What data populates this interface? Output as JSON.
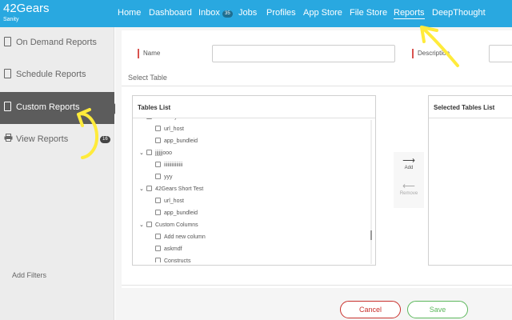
{
  "brand": {
    "name": "42Gears",
    "subtitle": "Sanity"
  },
  "nav": {
    "items": [
      {
        "label": "Home"
      },
      {
        "label": "Dashboard"
      },
      {
        "label": "Inbox",
        "badge": "35"
      },
      {
        "label": "Jobs"
      },
      {
        "label": "Profiles"
      },
      {
        "label": "App Store"
      },
      {
        "label": "File Store"
      },
      {
        "label": "Reports",
        "active": true
      },
      {
        "label": "DeepThought"
      }
    ]
  },
  "sidebar": {
    "items": [
      {
        "label": "On Demand Reports",
        "icon": "document-icon"
      },
      {
        "label": "Schedule Reports",
        "icon": "document-icon"
      },
      {
        "label": "Custom Reports",
        "icon": "document-icon",
        "active": true
      },
      {
        "label": "View Reports",
        "icon": "printer-icon",
        "badge": "16"
      }
    ]
  },
  "form": {
    "name_label": "Name",
    "description_label": "Description",
    "name_value": "",
    "description_value": "",
    "select_table_title": "Select Table",
    "tables_list_title": "Tables List",
    "selected_tables_title": "Selected Tables List",
    "add_label": "Add",
    "remove_label": "Remove",
    "add_filters_label": "Add Filters"
  },
  "tables_tree": [
    {
      "level": 0,
      "label": "ios analytics",
      "expanded": true
    },
    {
      "level": 1,
      "label": "url_host"
    },
    {
      "level": 1,
      "label": "app_bundleid"
    },
    {
      "level": 0,
      "label": "jjjjjjooo",
      "expanded": true
    },
    {
      "level": 1,
      "label": "iiiiiiiiiiiiiii"
    },
    {
      "level": 1,
      "label": "yyy"
    },
    {
      "level": 0,
      "label": "42Gears Short Test",
      "expanded": true
    },
    {
      "level": 1,
      "label": "url_host"
    },
    {
      "level": 1,
      "label": "app_bundleid"
    },
    {
      "level": 0,
      "label": "Custom Columns",
      "expanded": true
    },
    {
      "level": 1,
      "label": "Add new column"
    },
    {
      "level": 1,
      "label": "askmdf"
    },
    {
      "level": 1,
      "label": "Constructs"
    }
  ],
  "actions": {
    "cancel_label": "Cancel",
    "save_label": "Save"
  },
  "colors": {
    "topbar": "#29a8e0",
    "sidebar_active": "#5c5c5c",
    "cancel": "#c9302c",
    "save": "#5cb85c",
    "annotation": "#ffeb3b",
    "required_marker": "#d9534f"
  }
}
